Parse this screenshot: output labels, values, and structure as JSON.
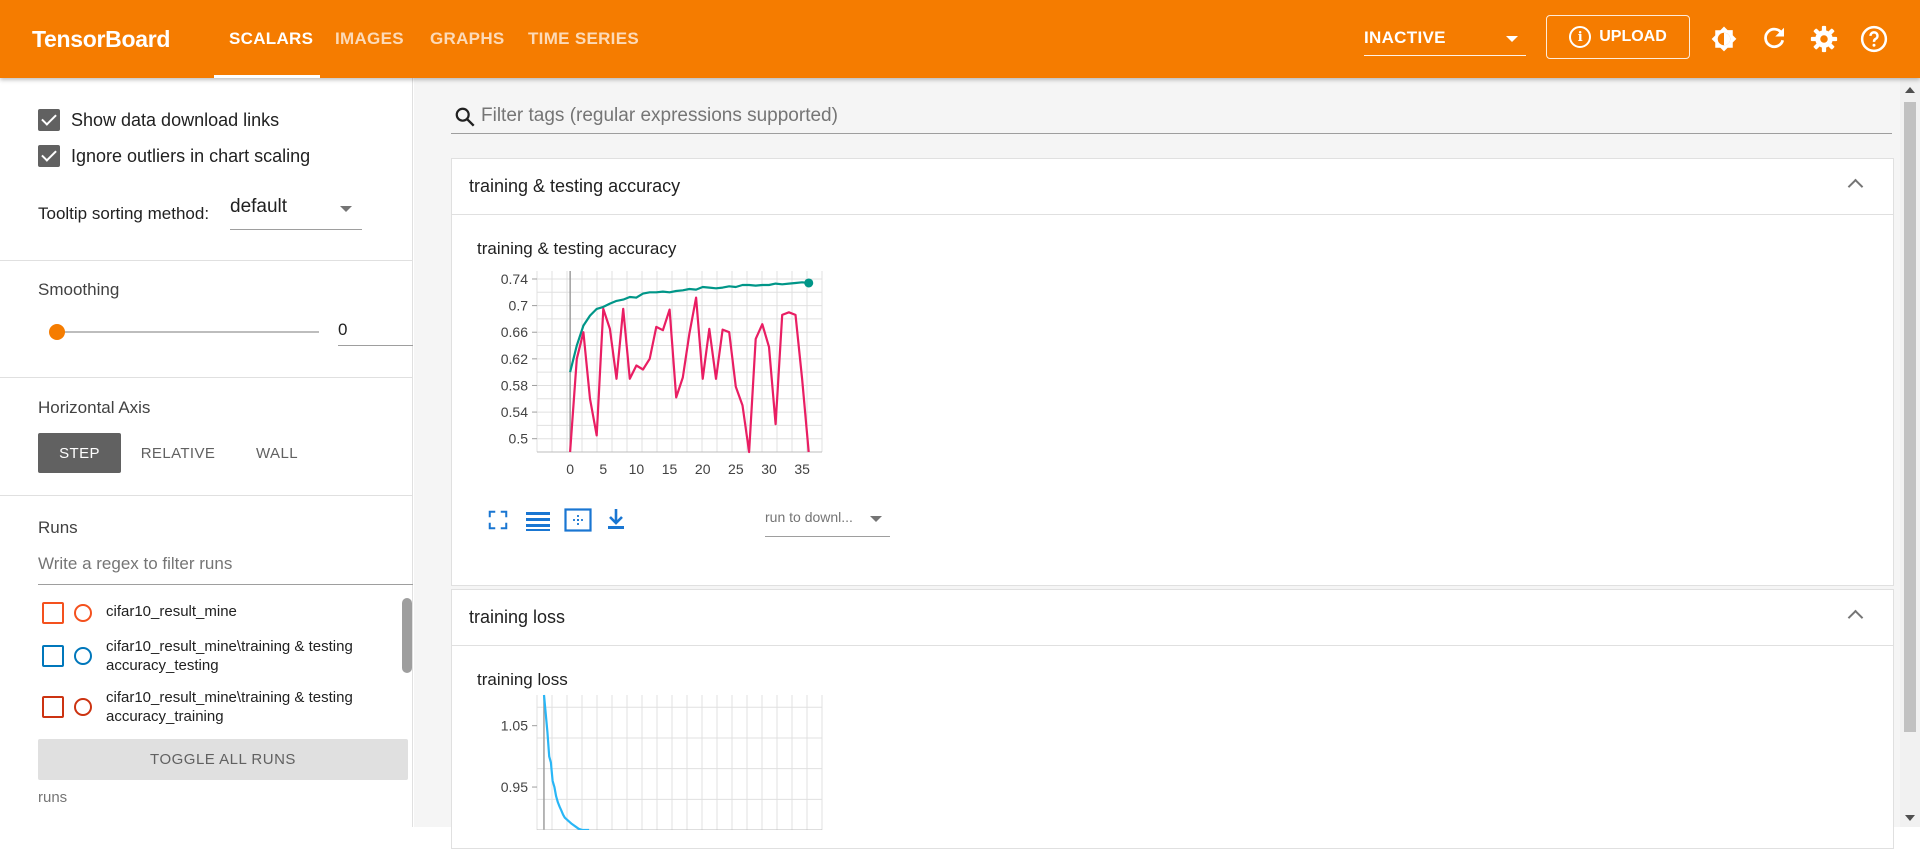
{
  "app": {
    "title": "TensorBoard",
    "tabs": [
      {
        "label": "SCALARS",
        "active": true
      },
      {
        "label": "IMAGES",
        "active": false
      },
      {
        "label": "GRAPHS",
        "active": false
      },
      {
        "label": "TIME SERIES",
        "active": false
      }
    ],
    "run_status": "INACTIVE",
    "upload_label": "UPLOAD",
    "icons": [
      "brightness-icon",
      "refresh-icon",
      "settings-icon",
      "help-icon"
    ],
    "accent_color": "#f57c00"
  },
  "sidebar": {
    "checkboxes": [
      {
        "label": "Show data download links",
        "checked": true
      },
      {
        "label": "Ignore outliers in chart scaling",
        "checked": true
      }
    ],
    "tooltip_label": "Tooltip sorting method:",
    "tooltip_value": "default",
    "smoothing_label": "Smoothing",
    "smoothing_value": "0",
    "horizontal_axis_label": "Horizontal Axis",
    "axis_options": [
      {
        "label": "STEP",
        "active": true
      },
      {
        "label": "RELATIVE",
        "active": false
      },
      {
        "label": "WALL",
        "active": false
      }
    ],
    "runs_label": "Runs",
    "runs_filter_placeholder": "Write a regex to filter runs",
    "runs": [
      {
        "name": "cifar10_result_mine",
        "color": "#f4511e"
      },
      {
        "name": "cifar10_result_mine\\training & testing accuracy_testing",
        "color": "#0077bb"
      },
      {
        "name": "cifar10_result_mine\\training & testing accuracy_training",
        "color": "#cc3311"
      }
    ],
    "toggle_all_label": "TOGGLE ALL RUNS",
    "footer": "runs"
  },
  "main": {
    "filter_placeholder": "Filter tags (regular expressions supported)",
    "cards": [
      {
        "header": "training & testing accuracy",
        "chart_title": "training & testing accuracy",
        "run_dropdown": "run to downl..."
      },
      {
        "header": "training loss",
        "chart_title": "training loss"
      }
    ]
  },
  "chart_data": [
    {
      "type": "line",
      "title": "training & testing accuracy",
      "xlabel": "",
      "ylabel": "",
      "x_ticks": [
        0,
        5,
        10,
        15,
        20,
        25,
        30,
        35
      ],
      "y_ticks": [
        0.5,
        0.54,
        0.58,
        0.62,
        0.66,
        0.7,
        0.74
      ],
      "xlim": [
        -5,
        38
      ],
      "ylim": [
        0.48,
        0.752
      ],
      "grid": true,
      "series": [
        {
          "color": "#009688",
          "x": [
            0,
            1,
            2,
            3,
            4,
            5,
            6,
            7,
            8,
            9,
            10,
            11,
            12,
            13,
            14,
            15,
            16,
            17,
            18,
            19,
            20,
            21,
            22,
            23,
            24,
            25,
            26,
            27,
            28,
            29,
            30,
            31,
            32,
            33,
            34,
            35,
            36
          ],
          "values": [
            0.6,
            0.64,
            0.67,
            0.685,
            0.695,
            0.698,
            0.703,
            0.707,
            0.709,
            0.713,
            0.712,
            0.718,
            0.72,
            0.72,
            0.721,
            0.72,
            0.722,
            0.723,
            0.725,
            0.724,
            0.728,
            0.727,
            0.726,
            0.727,
            0.729,
            0.728,
            0.731,
            0.731,
            0.73,
            0.731,
            0.731,
            0.733,
            0.732,
            0.733,
            0.734,
            0.735,
            0.734
          ]
        },
        {
          "color": "#e91e63",
          "x": [
            0,
            1,
            2,
            3,
            4,
            5,
            6,
            7,
            8,
            9,
            10,
            11,
            12,
            13,
            14,
            15,
            16,
            17,
            18,
            19,
            20,
            21,
            22,
            23,
            24,
            25,
            26,
            27,
            28,
            29,
            30,
            31,
            32,
            33,
            34,
            35,
            36
          ],
          "values": [
            0.48,
            0.62,
            0.66,
            0.56,
            0.505,
            0.695,
            0.665,
            0.59,
            0.695,
            0.59,
            0.61,
            0.604,
            0.62,
            0.668,
            0.663,
            0.694,
            0.562,
            0.592,
            0.658,
            0.712,
            0.59,
            0.665,
            0.59,
            0.664,
            0.66,
            0.578,
            0.55,
            0.48,
            0.65,
            0.672,
            0.638,
            0.522,
            0.686,
            0.69,
            0.686,
            0.59,
            0.48
          ]
        }
      ]
    },
    {
      "type": "line",
      "title": "training loss",
      "xlabel": "",
      "ylabel": "",
      "y_ticks": [
        0.95,
        1.05
      ],
      "ylim": [
        0.88,
        1.1
      ],
      "grid": true,
      "series": [
        {
          "color": "#29b6f6",
          "x": [
            0,
            0.5,
            1,
            1.5,
            2,
            2.5,
            3,
            3.5,
            4,
            4.5,
            5,
            5.5,
            6,
            7,
            8,
            9,
            10,
            11,
            12,
            13
          ],
          "values": [
            1.1,
            1.07,
            1.04,
            1.0,
            0.99,
            0.96,
            0.95,
            0.935,
            0.925,
            0.918,
            0.912,
            0.905,
            0.9,
            0.895,
            0.89,
            0.886,
            0.882,
            0.878,
            0.875,
            0.872
          ]
        }
      ]
    }
  ]
}
